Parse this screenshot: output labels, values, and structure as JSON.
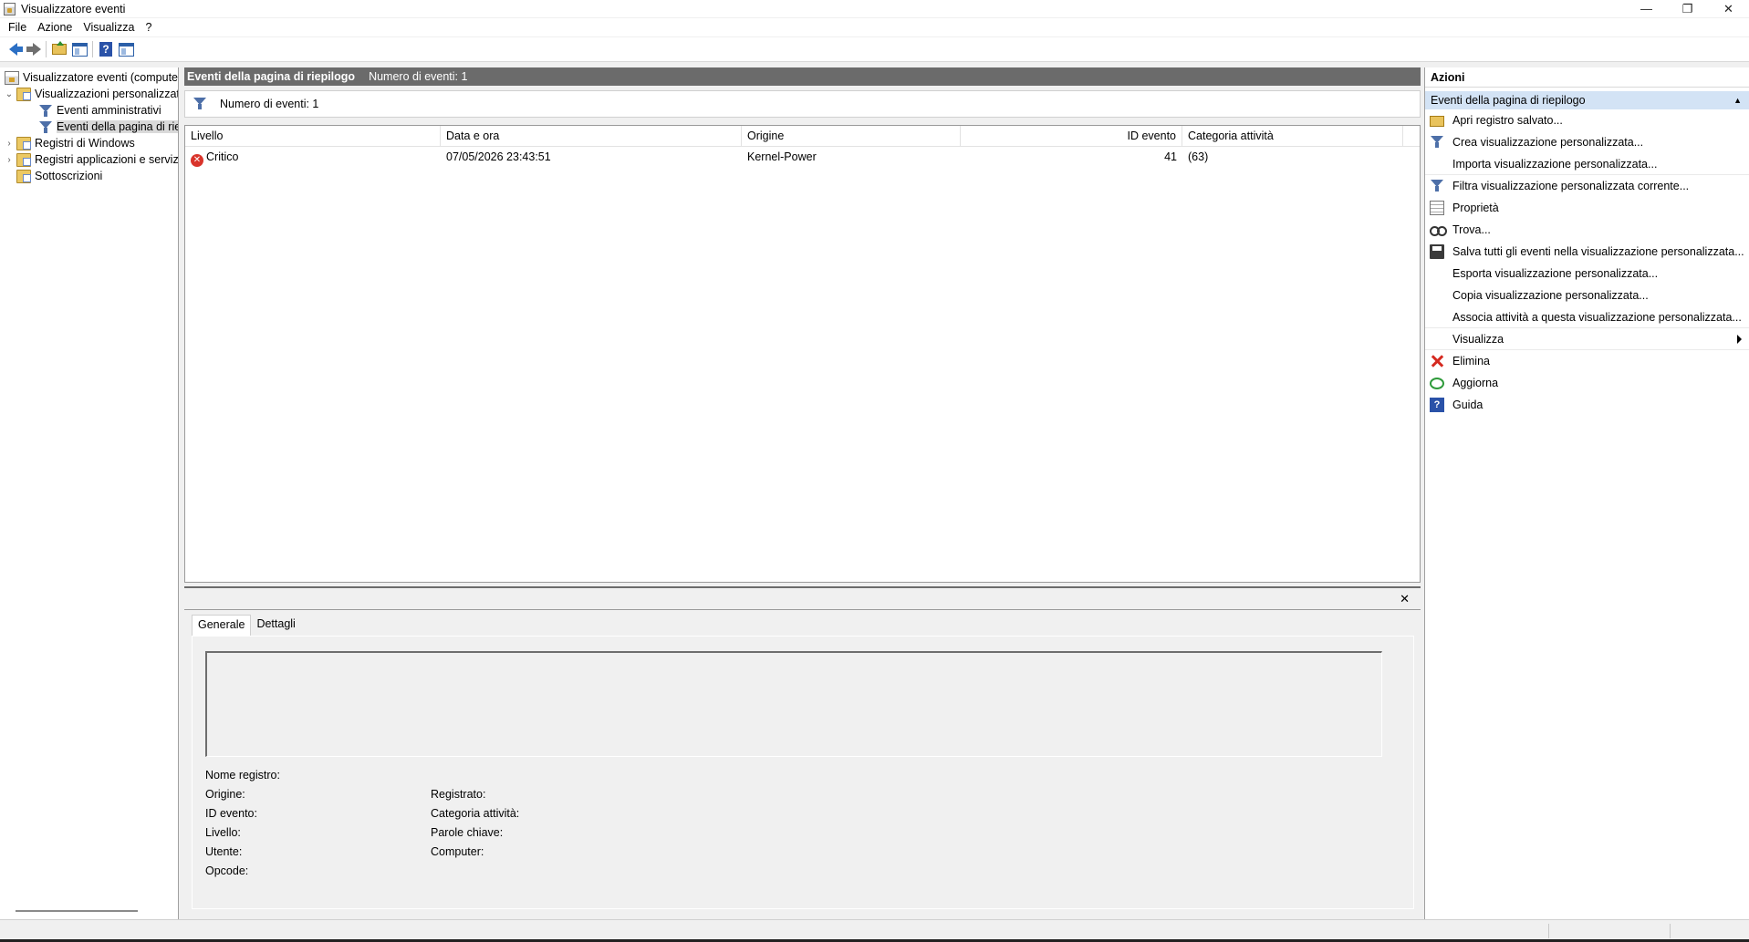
{
  "window": {
    "title": "Visualizzatore eventi",
    "controls": {
      "minimize": "—",
      "restore": "❐",
      "close": "✕"
    }
  },
  "menu": [
    "File",
    "Azione",
    "Visualizza",
    "?"
  ],
  "toolbar": {
    "icons": [
      "back-arrow-icon",
      "forward-arrow-icon",
      "folder-up-icon",
      "show-hide-console-tree-icon",
      "help-icon",
      "show-hide-action-pane-icon"
    ]
  },
  "tree": {
    "items": [
      {
        "label": "Visualizzatore eventi (computer locale)",
        "icon": "event-viewer-icon"
      },
      {
        "label": "Visualizzazioni personalizzate",
        "icon": "folder-icon",
        "expanded": true
      },
      {
        "label": "Eventi amministrativi",
        "icon": "filter-icon"
      },
      {
        "label": "Eventi della pagina di riepilogo",
        "icon": "filter-icon",
        "selected": true
      },
      {
        "label": "Registri di Windows",
        "icon": "folder-icon"
      },
      {
        "label": "Registri applicazioni e servizi",
        "icon": "folder-icon"
      },
      {
        "label": "Sottoscrizioni",
        "icon": "subscriptions-icon"
      }
    ],
    "expander_open": "⌄",
    "expander_closed": "›"
  },
  "center": {
    "header_title": "Eventi della pagina di riepilogo",
    "header_count": "Numero di eventi: 1",
    "filter_text": "Numero di eventi: 1",
    "columns": [
      "Livello",
      "Data e ora",
      "Origine",
      "ID evento",
      "Categoria attività"
    ],
    "rows": [
      {
        "level": "Critico",
        "datetime": "07/05/2026 23:43:51",
        "source": "Kernel-Power",
        "event_id": "41",
        "category": "(63)"
      }
    ]
  },
  "details": {
    "close": "✕",
    "tabs": [
      "Generale",
      "Dettagli"
    ],
    "fields_left": [
      "Nome registro:",
      "Origine:",
      "ID evento:",
      "Livello:",
      "Utente:",
      "Opcode:"
    ],
    "fields_right": [
      "Registrato:",
      "Categoria attività:",
      "Parole chiave:",
      "Computer:"
    ]
  },
  "actions": {
    "title": "Azioni",
    "group": "Eventi della pagina di riepilogo",
    "group_caret": "▲",
    "items": [
      {
        "label": "Apri registro salvato...",
        "icon": "open-log-icon"
      },
      {
        "label": "Crea visualizzazione personalizzata...",
        "icon": "create-view-icon"
      },
      {
        "label": "Importa visualizzazione personalizzata...",
        "icon": ""
      },
      {
        "label": "Filtra visualizzazione personalizzata corrente...",
        "icon": "filter-icon"
      },
      {
        "label": "Proprietà",
        "icon": "properties-icon"
      },
      {
        "label": "Trova...",
        "icon": "find-icon"
      },
      {
        "label": "Salva tutti gli eventi nella visualizzazione personalizzata...",
        "icon": "save-icon"
      },
      {
        "label": "Esporta visualizzazione personalizzata...",
        "icon": ""
      },
      {
        "label": "Copia visualizzazione personalizzata...",
        "icon": ""
      },
      {
        "label": "Associa attività a questa visualizzazione personalizzata...",
        "icon": ""
      },
      {
        "label": "Visualizza",
        "icon": "",
        "submenu": true
      },
      {
        "label": "Elimina",
        "icon": "delete-icon"
      },
      {
        "label": "Aggiorna",
        "icon": "refresh-icon"
      },
      {
        "label": "Guida",
        "icon": "help-icon"
      }
    ]
  },
  "colors": {
    "header_bg": "#6b6b6b",
    "group_bg": "#d3e3f5",
    "critical": "#d9342b",
    "selection": "#d9d9d9"
  }
}
